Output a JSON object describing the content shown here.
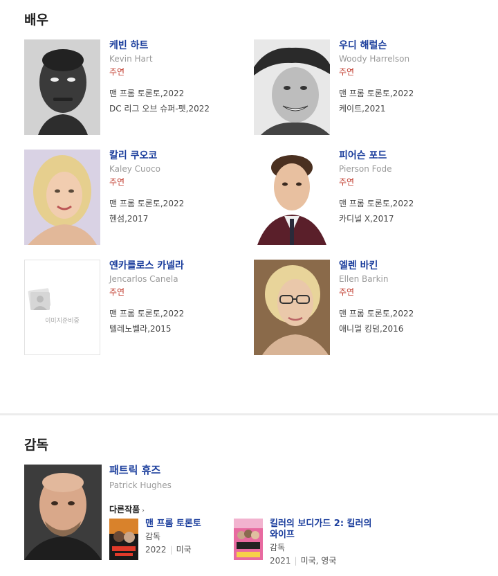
{
  "actors_section": {
    "title": "배우"
  },
  "actors": [
    {
      "name": "케빈 하트",
      "english": "Kevin Hart",
      "role": "주연",
      "works": [
        "맨 프롬 토론토,2022",
        "DC 리그 오브 슈퍼-펫,2022"
      ]
    },
    {
      "name": "우디 해럴슨",
      "english": "Woody Harrelson",
      "role": "주연",
      "works": [
        "맨 프롬 토론토,2022",
        "케이트,2021"
      ]
    },
    {
      "name": "칼리 쿠오코",
      "english": "Kaley Cuoco",
      "role": "주연",
      "works": [
        "맨 프롬 토론토,2022",
        "헨섬,2017"
      ]
    },
    {
      "name": "피어슨 포드",
      "english": "Pierson Fode",
      "role": "주연",
      "works": [
        "맨 프롬 토론토,2022",
        "카디널 X,2017"
      ]
    },
    {
      "name": "옌카를로스 카넬라",
      "english": "Jencarlos Canela",
      "role": "주연",
      "works": [
        "맨 프롬 토론토,2022",
        "텔레노벨라,2015"
      ],
      "photo_placeholder": "이미지준비중"
    },
    {
      "name": "엘렌 바킨",
      "english": "Ellen Barkin",
      "role": "주연",
      "works": [
        "맨 프롬 토론토,2022",
        "애니멀 킹덤,2016"
      ]
    }
  ],
  "director_section": {
    "title": "감독"
  },
  "director": {
    "name": "패트릭 휴즈",
    "english": "Patrick Hughes",
    "other_works_label": "다른작품",
    "other_works_chevron": "›",
    "films": [
      {
        "title": "맨 프롬 토론토",
        "role": "감독",
        "year": "2022",
        "country": "미국"
      },
      {
        "title": "킬러의 보디가드 2: 킬러의 와이프",
        "role": "감독",
        "year": "2021",
        "country": "미국, 영국"
      }
    ]
  }
}
